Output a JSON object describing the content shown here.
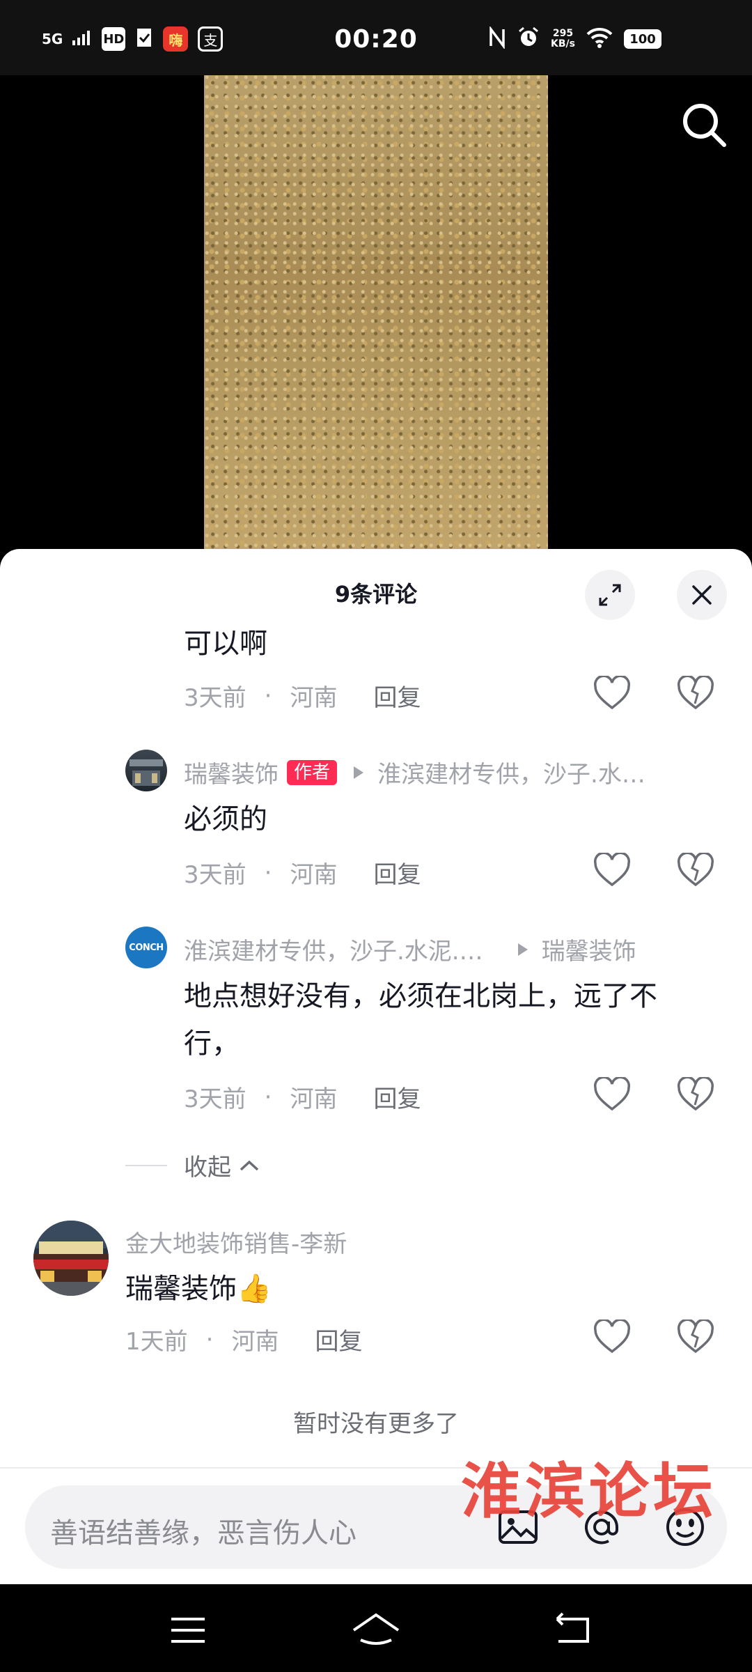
{
  "status_bar": {
    "signal": "5G",
    "hd": "HD",
    "app1": "嗨",
    "app2": "支",
    "time": "00:20",
    "speed_value": "295",
    "speed_unit": "KB/s",
    "battery": "100"
  },
  "sheet": {
    "title": "9条评论"
  },
  "comments": [
    {
      "text": "可以啊",
      "time": "3天前",
      "location": "河南",
      "reply_label": "回复"
    },
    {
      "user": "瑞馨装饰",
      "badge": "作者",
      "reply_to": "淮滨建材专供，沙子.水…",
      "text": "必须的",
      "time": "3天前",
      "location": "河南",
      "reply_label": "回复"
    },
    {
      "user": "淮滨建材专供，沙子.水泥.…",
      "reply_to": "瑞馨装饰",
      "text_line1": "地点想好没有，必须在北岗上，远了不",
      "text_line2": "行，",
      "time": "3天前",
      "location": "河南",
      "reply_label": "回复",
      "avatar_text": "CONCH"
    },
    {
      "user": "金大地装饰销售-李新",
      "text": "瑞馨装饰👍",
      "time": "1天前",
      "location": "河南",
      "reply_label": "回复"
    }
  ],
  "collapse_label": "收起",
  "no_more": "暂时没有更多了",
  "input": {
    "placeholder": "善语结善缘，恶言伤人心"
  },
  "watermark": "淮滨论坛",
  "colors": {
    "accent": "#fe2c55",
    "watermark": "#e8443a",
    "muted": "#a1a3aa"
  }
}
